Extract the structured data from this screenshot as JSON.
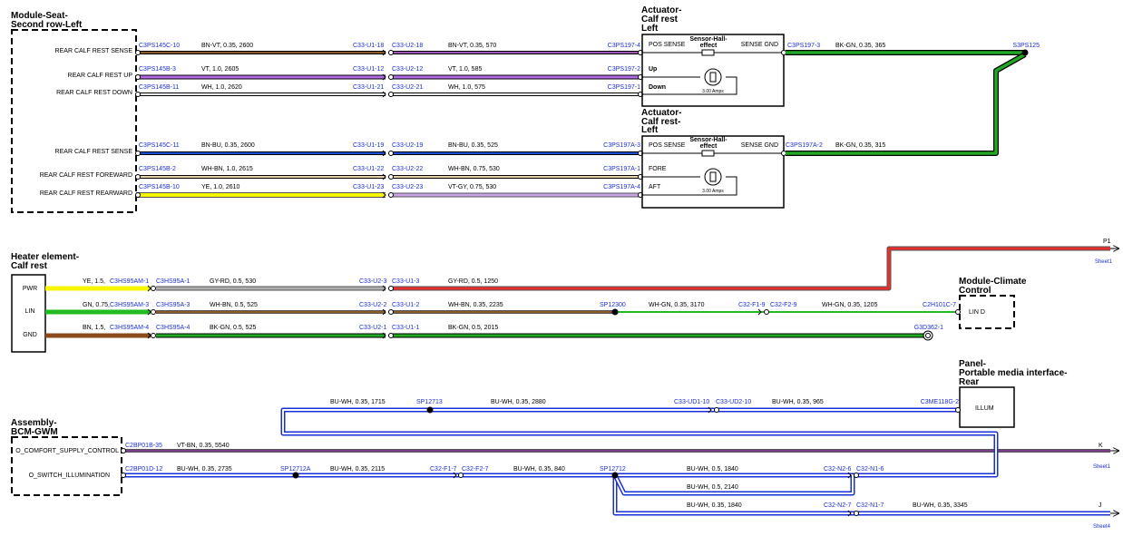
{
  "modules": {
    "seat": {
      "title": "Module-Seat-",
      "title2": "Second row-Left"
    },
    "act1": {
      "title": "Actuator-",
      "title2": "Calf rest",
      "title3": "Left",
      "pos": "POS SENSE",
      "hall": "Sensor-Hall-",
      "hall2": "effect",
      "gnd": "SENSE GND",
      "up": "Up",
      "down": "Down",
      "amps": "3.00 Amps"
    },
    "act2": {
      "title": "Actuator-",
      "title2": "Calf rest-",
      "title3": "Left",
      "pos": "POS SENSE",
      "hall": "Sensor-Hall-",
      "hall2": "effect",
      "gnd": "SENSE GND",
      "fore": "FORE",
      "aft": "AFT",
      "amps": "3.00 Amps"
    },
    "heater": {
      "title": "Heater element-",
      "title2": "Calf rest",
      "pwr": "PWR",
      "lin": "LIN",
      "gnd": "GND"
    },
    "climate": {
      "title": "Module-Climate",
      "title2": "Control",
      "lin": "LIN D"
    },
    "panel": {
      "title": "Panel-",
      "title2": "Portable media interface-",
      "title3": "Rear",
      "illum": "ILLUM"
    },
    "bcm": {
      "title": "Assembly-",
      "title2": "BCM-GWM",
      "pin1": "O_COMFORT_SUPPLY_CONTROL",
      "pin2": "O_SWITCH_ILLUMINATION"
    }
  },
  "pins": {
    "p1": "REAR CALF REST SENSE",
    "p2": "REAR CALF REST UP",
    "p3": "REAR CALF REST DOWN",
    "p4": "REAR CALF REST SENSE",
    "p5": "REAR CALF REST FOREWARD",
    "p6": "REAR CALF REST REARWARD"
  },
  "connectors": {
    "s1a": "C3PS145C-10",
    "s1b": "C33-U1-18",
    "s1c": "C33-U2-18",
    "s1d": "C3PS197-4",
    "s2a": "C3PS145B-3",
    "s2b": "C33-U1-12",
    "s2c": "C33-U2-12",
    "s2d": "C3PS197-2",
    "s3a": "C3PS145B-11",
    "s3b": "C33-U1-21",
    "s3c": "C33-U2-21",
    "s3d": "C3PS197-1",
    "s4a": "C3PS145C-11",
    "s4b": "C33-U1-19",
    "s4c": "C33-U2-19",
    "s4d": "C3PS197A-3",
    "s5a": "C3PS145B-2",
    "s5b": "C33-U1-22",
    "s5c": "C33-U2-22",
    "s5d": "C3PS197A-1",
    "s6a": "C3PS145B-10",
    "s6b": "C33-U1-23",
    "s6c": "C33-U2-23",
    "s6d": "C3PS197A-4",
    "g1": "C3PS197-3",
    "g2": "C3PS197A-2",
    "splice1": "S3PS125",
    "h1a": "C3HS95AM-1",
    "h1b": "C3HS95A-1",
    "h1c": "C33-U2-3",
    "h1d": "C33-U1-3",
    "h2a": "C3HS95AM-3",
    "h2b": "C3HS95A-3",
    "h2c": "C33-U2-2",
    "h2d": "C33-U1-2",
    "h3a": "C3HS95AM-4",
    "h3b": "C3HS95A-4",
    "h3c": "C33-U2-1",
    "h3d": "C33-U1-1",
    "sp1": "SP12300",
    "cf1": "C32-F1-9",
    "cf2": "C32-F2-9",
    "clin": "C2H101C-7",
    "gnd": "G3D362-1",
    "sp2": "SP12713",
    "ud1": "C33-UD1-10",
    "ud2": "C33-UD2-10",
    "me": "C3ME118G-2",
    "b1": "C2BP01B-35",
    "b2": "C2BP01D-12",
    "sp3": "SP12712A",
    "f7a": "C32-F1-7",
    "f7b": "C32-F2-7",
    "sp4": "SP12712",
    "n6a": "C32-N2-6",
    "n6b": "C32-N1-6",
    "n7a": "C32-N2-7",
    "n7b": "C32-N1-7"
  },
  "wires": {
    "w1a": "BN-VT,  0.35,  2600",
    "w1b": "BN-VT,  0.35,  570",
    "w2a": "VT,  1.0,  2605",
    "w2b": "VT,  1.0,  585",
    "w3a": "WH,  1.0,  2620",
    "w3b": "WH,  1.0,  575",
    "w4a": "BN-BU,  0.35,  2600",
    "w4b": "BN-BU,  0.35,  525",
    "w5a": "WH-BN,  1.0,  2615",
    "w5b": "WH-BN,  0.75,  530",
    "w6a": "YE,  1.0,  2610",
    "w6b": "VT-GY,  0.75,  530",
    "g1": "BK-GN,  0.35,  365",
    "g2": "BK-GN,  0.35,  315",
    "h1a": "YE,  1.5,",
    "h1b": "GY-RD,  0.5,  530",
    "h1c": "GY-RD,  0.5,  1250",
    "h2a": "GN,  0.75,",
    "h2b": "WH-BN,  0.5,  525",
    "h2c": "WH-BN,  0.35,  2235",
    "h2d": "WH-GN,  0.35,  3170",
    "h2e": "WH-GN,  0.35,  1205",
    "h3a": "BN,  1.5,",
    "h3b": "BK-GN,  0.5,  525",
    "h3c": "BK-GN,  0.5,  2015",
    "i1": "BU-WH,  0.35,  1715",
    "i2": "BU-WH,  0.35,  2880",
    "i3": "BU-WH,  0.35,  965",
    "k1": "VT-BN,  0.35,  5540",
    "b1": "BU-WH,  0.35,  2735",
    "b2": "BU-WH,  0.35,  2115",
    "b3": "BU-WH,  0.35,  840",
    "b4": "BU-WH,  0.5,  1840",
    "b5": "BU-WH,  0.5,  2140",
    "b6": "BU-WH,  0.35,  1840",
    "b7": "BU-WH,  0.35,  3345"
  },
  "offpage": {
    "p1": "P1",
    "p1s": "Sheet1",
    "k": "K",
    "ks": "Sheet1",
    "j": "J",
    "js": "Sheet4"
  }
}
